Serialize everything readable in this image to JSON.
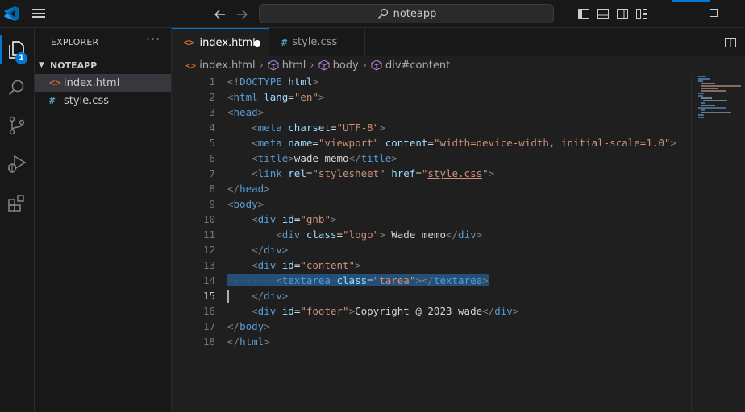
{
  "titlebar": {
    "search_text": "noteapp"
  },
  "activity_bar": {
    "items": [
      "explorer",
      "search",
      "source-control",
      "run-and-debug",
      "extensions"
    ],
    "explorer_badge": "1"
  },
  "sidebar": {
    "title": "EXPLORER",
    "more_label": "···",
    "folder": "NOTEAPP",
    "files": [
      {
        "name": "index.html",
        "icon": "<>",
        "selected": true
      },
      {
        "name": "style.css",
        "icon": "#",
        "selected": false
      }
    ]
  },
  "tabs": [
    {
      "label": "index.html",
      "icon": "<>",
      "active": true,
      "modified": true
    },
    {
      "label": "style.css",
      "icon": "#",
      "active": false,
      "modified": false
    }
  ],
  "breadcrumb": [
    "index.html",
    "html",
    "body",
    "div#content"
  ],
  "editor": {
    "current_line": 15,
    "line_numbers": [
      "1",
      "2",
      "3",
      "4",
      "5",
      "6",
      "7",
      "8",
      "9",
      "10",
      "11",
      "12",
      "13",
      "14",
      "15",
      "16",
      "17",
      "18"
    ]
  },
  "colors": {
    "accent": "#0078d4",
    "tag": "#569cd6",
    "attribute": "#9cdcfe",
    "string": "#ce9178",
    "punctuation": "#808080",
    "selection": "#264f78"
  }
}
